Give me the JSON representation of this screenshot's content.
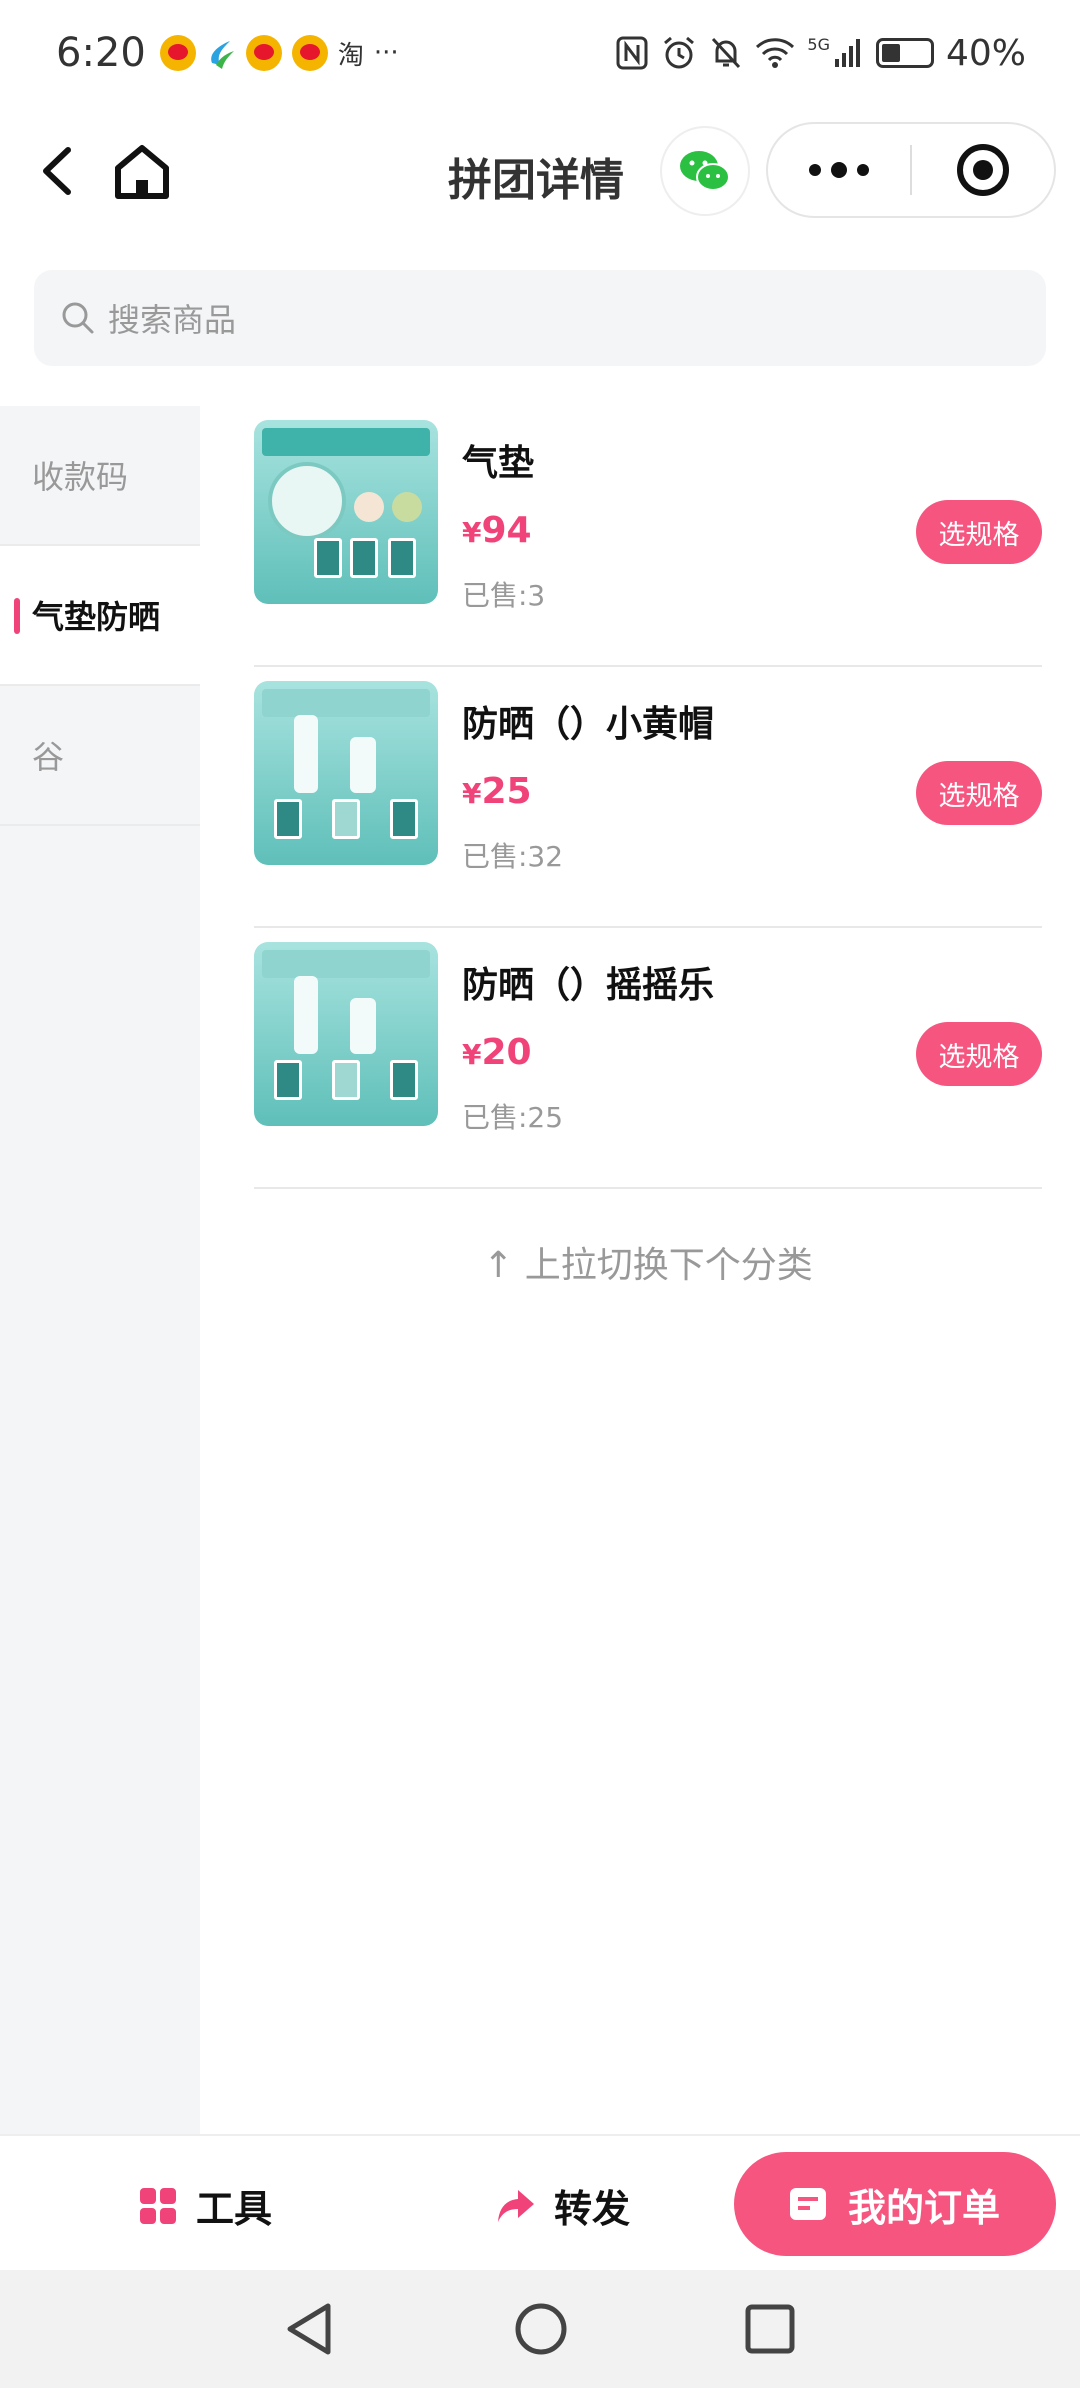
{
  "status_bar": {
    "time": "6:20",
    "taobao_label": "淘",
    "more_label": "···",
    "network_label": "5G",
    "battery": "40%",
    "icons": [
      "weibo-icon",
      "china-mobile-icon",
      "nfc-icon",
      "alarm-icon",
      "mute-icon",
      "wifi-icon",
      "signal-icon",
      "battery-icon"
    ]
  },
  "navbar": {
    "title": "拼团详情",
    "icons": [
      "back-icon",
      "home-icon",
      "wechat-icon",
      "more-dots-icon",
      "close-target-icon"
    ]
  },
  "search": {
    "placeholder": "搜索商品"
  },
  "categories": [
    {
      "label": "收款码",
      "active": false
    },
    {
      "label": "气垫防晒",
      "active": true
    },
    {
      "label": "谷",
      "active": false
    }
  ],
  "products": [
    {
      "name": "气垫",
      "currency": "¥",
      "price": "94",
      "sold": "已售:3",
      "button": "选规格"
    },
    {
      "name": "防晒（）小黄帽",
      "currency": "¥",
      "price": "25",
      "sold": "已售:32",
      "button": "选规格"
    },
    {
      "name": "防晒（）摇摇乐",
      "currency": "¥",
      "price": "20",
      "sold": "已售:25",
      "button": "选规格"
    }
  ],
  "pull_up_hint": "↑ 上拉切换下个分类",
  "bottom_bar": {
    "tools_label": "工具",
    "share_label": "转发",
    "orders_label": "我的订单"
  },
  "colors": {
    "accent": "#f5557f",
    "price": "#f0437a",
    "sidebar_bg": "#f4f5f7"
  }
}
